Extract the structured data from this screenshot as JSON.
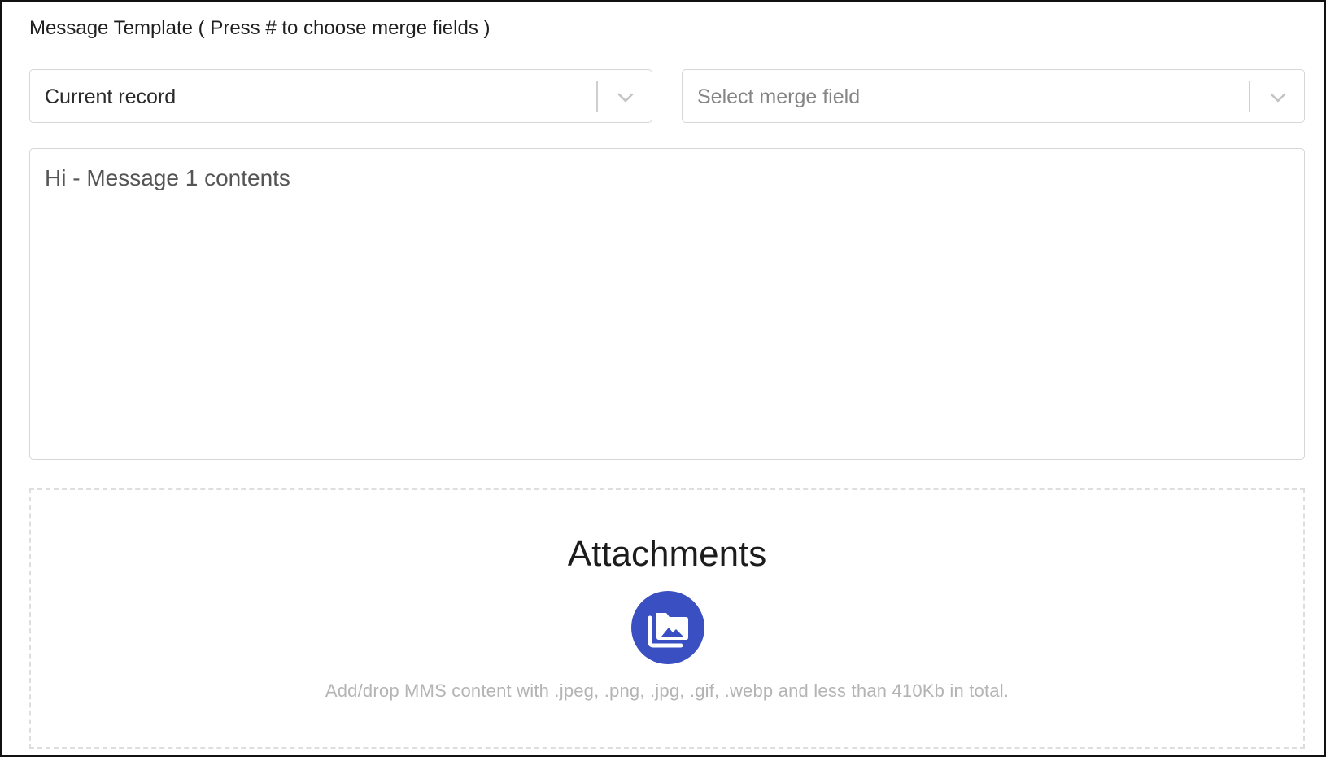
{
  "form": {
    "section_label": "Message Template ( Press # to choose merge fields )",
    "record_select": {
      "value": "Current record",
      "icon": "chevron-down-icon"
    },
    "merge_field_select": {
      "placeholder": "Select merge field",
      "icon": "chevron-down-icon"
    },
    "message_body": "Hi - Message 1 contents"
  },
  "attachments": {
    "title": "Attachments",
    "icon": "image-library-icon",
    "hint": "Add/drop MMS content with .jpeg, .png, .jpg, .gif, .webp and less than 410Kb in total."
  },
  "colors": {
    "accent": "#3a4fc1",
    "border": "#d6d6d6",
    "placeholder_text": "#858585",
    "hint_text": "#b4b4b4"
  }
}
